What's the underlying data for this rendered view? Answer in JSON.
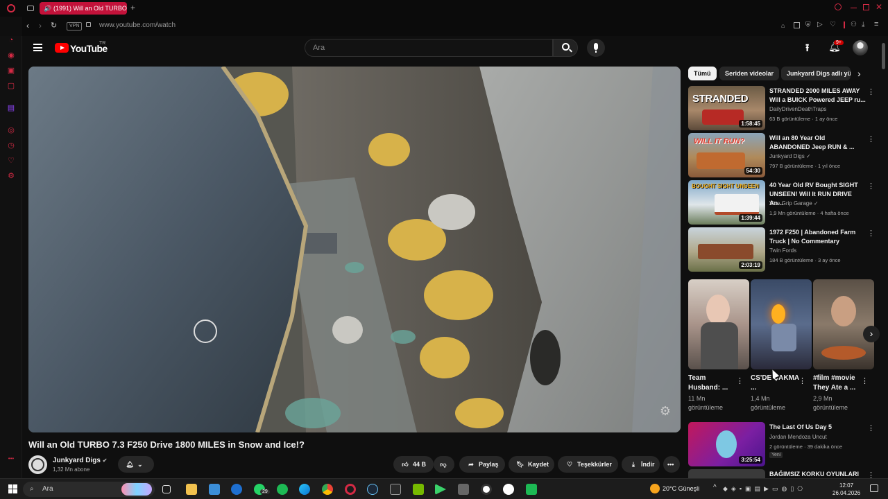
{
  "browser": {
    "tab_title": "(1991) Will an Old TURBO",
    "url": "www.youtube.com/watch",
    "vpn_label": "VPN",
    "accent_color": "#c3123a"
  },
  "youtube": {
    "logo_text": "YouTube",
    "country_code": "TR",
    "search_placeholder": "Ara",
    "notification_badge": "9+"
  },
  "video": {
    "title": "Will an Old TURBO 7.3 F250 Drive 1800 MILES in Snow and Ice!?",
    "channel_name": "Junkyard Digs",
    "subscribers": "1,32 Mn abone",
    "likes": "44 B",
    "share_label": "Paylaş",
    "save_label": "Kaydet",
    "thanks_label": "Teşekkürler",
    "download_label": "İndir"
  },
  "chips": [
    "Tümü",
    "Seriden videolar",
    "Junkyard Digs adlı yü"
  ],
  "recommendations": [
    {
      "title": "STRANDED 2000 MILES AWAY Will a BUICK Powered JEEP ru...",
      "channel": "DailyDrivenDeathTraps",
      "meta": "63 B görüntüleme · 1 ay önce",
      "duration": "1:58:45",
      "thumb_text": "STRANDED"
    },
    {
      "title": "Will an 80 Year Old ABANDONED Jeep RUN & ...",
      "channel": "Junkyard Digs ✓",
      "meta": "797 B görüntüleme · 1 yıl önce",
      "duration": "54:30",
      "thumb_text": "WILL IT RUN?"
    },
    {
      "title": "40 Year Old RV Bought SIGHT UNSEEN! Will It RUN DRIVE An...",
      "channel": "Vice Grip Garage ✓",
      "meta": "1,9 Mn görüntüleme · 4 hafta önce",
      "duration": "1:39:44",
      "thumb_text": "BOUGHT SIGHT UNSEEN"
    },
    {
      "title": "1972 F250 | Abandoned Farm Truck | No Commentary",
      "channel": "Twin Fords",
      "meta": "184 B görüntüleme · 3 ay önce",
      "duration": "2:03:19",
      "thumb_text": ""
    }
  ],
  "shorts": [
    {
      "title": "Team Husband: ...",
      "views": "11 Mn görüntüleme"
    },
    {
      "title": "CS'DE ÇAKMA ...",
      "views": "1,4 Mn görüntüleme"
    },
    {
      "title": "#film #movie They Ate a ...",
      "views": "2,9 Mn görüntüleme"
    }
  ],
  "recommendations_2": [
    {
      "title": "The Last Of Us Day 5",
      "channel": "Jordan Mendoza Uncut",
      "meta": "2 görüntüleme · 39 dakika önce",
      "badge": "Yeni",
      "duration": "3:25:54"
    },
    {
      "title": "BAĞIMSIZ KORKU OYUNLARI",
      "channel": "",
      "meta": "",
      "duration": ""
    }
  ],
  "taskbar": {
    "search_label": "Ara",
    "weather": "20°C Güneşli",
    "time": "12:07",
    "date": "26.04.2026",
    "whatsapp_badge": "29"
  }
}
